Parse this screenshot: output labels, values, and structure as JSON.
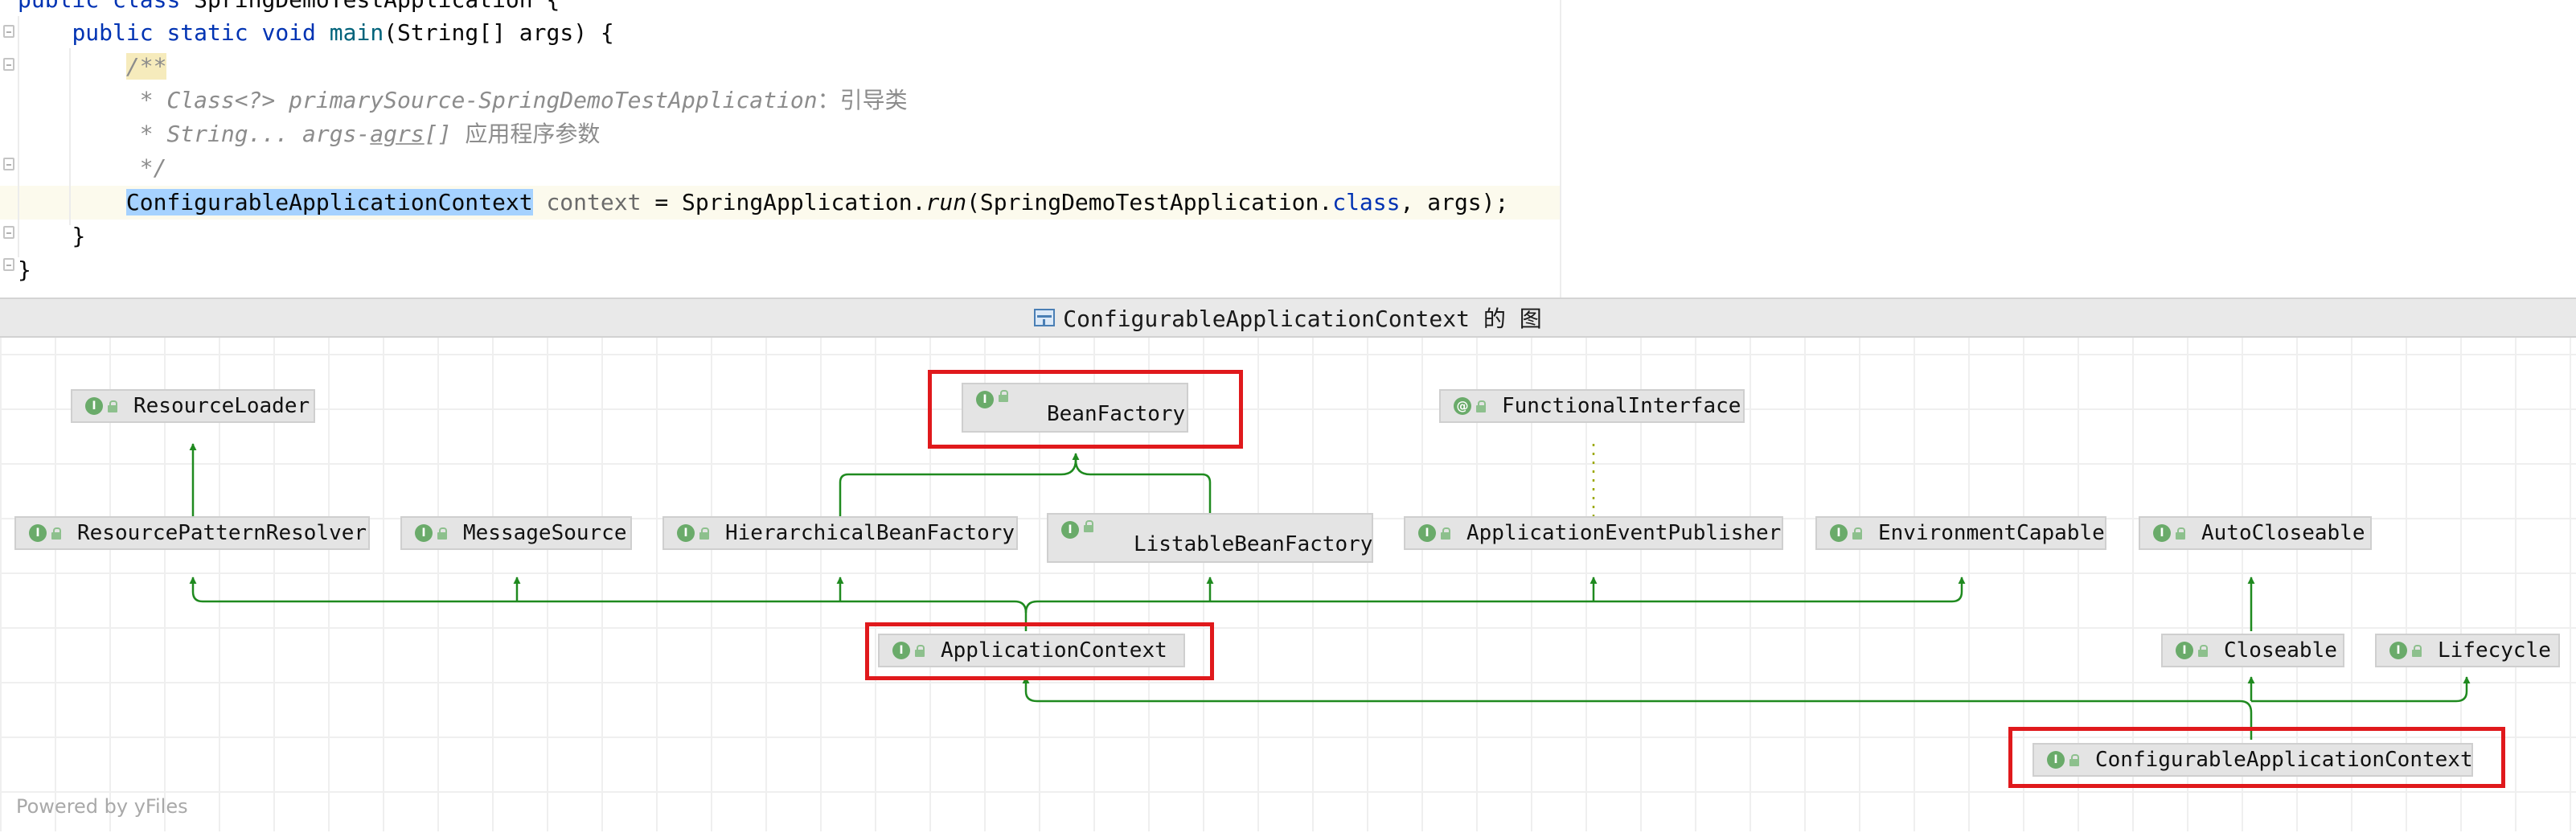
{
  "editor": {
    "line0": {
      "kw1": "public",
      "kw2": "class",
      "name": "SpringDemoTestApplication",
      "brace": "{"
    },
    "line1": {
      "kw1": "public",
      "kw2": "static",
      "kw3": "void",
      "fn": "main",
      "params": "(String[] args) {"
    },
    "line2": {
      "comment": "/**"
    },
    "line3": {
      "prefix": " * Class<?> ",
      "param": "primarySource-SpringDemoTestApplication",
      "sep": "：",
      "cn": "引导类"
    },
    "line4": {
      "prefix": " * String... args-",
      "und": "agrs",
      "rest": "[] ",
      "cn": "应用程序参数"
    },
    "line5": {
      "comment": " */"
    },
    "line6": {
      "type": "ConfigurableApplicationContext",
      "var": "context",
      "eq": " = SpringApplication.",
      "call": "run",
      "args_open": "(SpringDemoTestApplication.",
      "kw": "class",
      "args_close": ", args);"
    },
    "line7": {
      "brace": "}"
    },
    "line8": {
      "brace": "}"
    }
  },
  "diagram": {
    "title": "ConfigurableApplicationContext 的 图",
    "powered_by": "Powered by yFiles",
    "nodes": {
      "resource_loader": {
        "label": "ResourceLoader",
        "badge": "I"
      },
      "bean_factory": {
        "label": "BeanFactory",
        "badge": "I"
      },
      "functional_interface": {
        "label": "FunctionalInterface",
        "badge": "@"
      },
      "resource_pattern_resolver": {
        "label": "ResourcePatternResolver",
        "badge": "I"
      },
      "message_source": {
        "label": "MessageSource",
        "badge": "I"
      },
      "hierarchical_bean_factory": {
        "label": "HierarchicalBeanFactory",
        "badge": "I"
      },
      "listable_bean_factory": {
        "label": "ListableBeanFactory",
        "badge": "I"
      },
      "application_event_publisher": {
        "label": "ApplicationEventPublisher",
        "badge": "I"
      },
      "environment_capable": {
        "label": "EnvironmentCapable",
        "badge": "I"
      },
      "auto_closeable": {
        "label": "AutoCloseable",
        "badge": "I"
      },
      "application_context": {
        "label": "ApplicationContext",
        "badge": "I"
      },
      "closeable": {
        "label": "Closeable",
        "badge": "I"
      },
      "lifecycle": {
        "label": "Lifecycle",
        "badge": "I"
      },
      "configurable_application_context": {
        "label": "ConfigurableApplicationContext",
        "badge": "I"
      }
    },
    "colors": {
      "edge": "#1f8a1f",
      "highlight": "#e0191c",
      "annotation_edge": "#9aa800"
    }
  }
}
